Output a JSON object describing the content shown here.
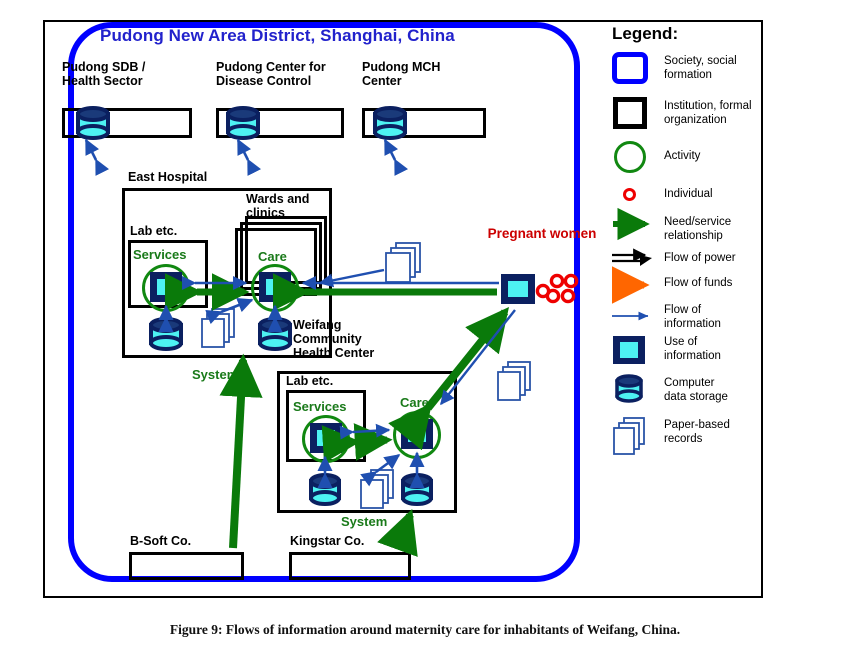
{
  "figure": {
    "caption": "Figure 9: Flows of information around maternity care for inhabitants of Weifang, China."
  },
  "colors": {
    "society_blue": "#0000ff",
    "title_blue": "#2222cc",
    "activity_green": "#118811",
    "need_service_green": "#0a7a0a",
    "individual_red": "#ee0000",
    "pregnant_label_red": "#cc0000",
    "funds_orange": "#ff6600",
    "info_arrow_blue": "#1f4fb0",
    "icon_navy": "#0b2060",
    "icon_cyan": "#4df2f2",
    "institution_black": "#000000"
  },
  "diagram": {
    "society_label": "Pudong New Area District, Shanghai, China",
    "top_institutions": [
      {
        "label": "Pudong SDB /\nHealth Sector",
        "icon": "computer-data-storage"
      },
      {
        "label": "Pudong Center for\nDisease Control",
        "icon": "computer-data-storage"
      },
      {
        "label": "Pudong MCH\nCenter",
        "icon": "computer-data-storage"
      }
    ],
    "east_hospital": {
      "label": "East Hospital",
      "lab_label": "Lab etc.",
      "wards_label": "Wards and\nclinics",
      "services_label": "Services",
      "care_label": "Care",
      "system_label": "System"
    },
    "weifang_center": {
      "label": "Weifang\nCommunity\nHealth Center",
      "lab_label": "Lab etc.",
      "services_label": "Services",
      "care_label": "Care",
      "system_label": "System"
    },
    "clients": {
      "label": "Pregnant\nwomen",
      "individual_count": 5
    },
    "vendors": [
      {
        "label": "B-Soft Co."
      },
      {
        "label": "Kingstar Co."
      }
    ]
  },
  "legend": {
    "title": "Legend:",
    "items": [
      {
        "icon": "rounded-blue-box-icon",
        "label": "Society, social\nformation"
      },
      {
        "icon": "black-box-icon",
        "label": "Institution, formal\norganization"
      },
      {
        "icon": "green-circle-icon",
        "label": "Activity"
      },
      {
        "icon": "red-circle-icon",
        "label": "Individual"
      },
      {
        "icon": "green-arrow-icon",
        "label": "Need/service\nrelationship"
      },
      {
        "icon": "black-double-arrow-icon",
        "label": "Flow of power"
      },
      {
        "icon": "orange-arrow-icon",
        "label": "Flow of funds"
      },
      {
        "icon": "thin-blue-arrow-icon",
        "label": "Flow of\ninformation"
      },
      {
        "icon": "use-of-information-icon",
        "label": "Use of\ninformation"
      },
      {
        "icon": "computer-data-storage-icon",
        "label": "Computer\ndata storage"
      },
      {
        "icon": "paper-records-icon",
        "label": "Paper-based\nrecords"
      }
    ]
  }
}
